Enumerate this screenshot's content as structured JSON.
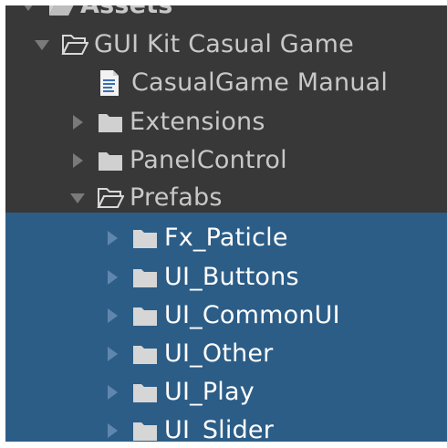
{
  "header": {
    "title": "Assets"
  },
  "tree": {
    "root": {
      "label": "GUI Kit Casual Game",
      "expanded": true
    },
    "children": [
      {
        "label": "CasualGame Manual",
        "type": "document"
      },
      {
        "label": "Extensions",
        "type": "folder",
        "expanded": false
      },
      {
        "label": "PanelControl",
        "type": "folder",
        "expanded": false
      },
      {
        "label": "Prefabs",
        "type": "folder",
        "expanded": true
      }
    ],
    "prefabs": [
      {
        "label": "Fx_Paticle",
        "selected": true
      },
      {
        "label": "UI_Buttons",
        "selected": true
      },
      {
        "label": "UI_CommonUI",
        "selected": true
      },
      {
        "label": "UI_Other",
        "selected": true
      },
      {
        "label": "UI_Play",
        "selected": true
      },
      {
        "label": "UI_Slider",
        "selected": true
      }
    ]
  },
  "colors": {
    "panel_bg": "#383838",
    "selection_bg": "#2c5d87",
    "text": "#c8c8c8",
    "text_selected": "#ffffff"
  }
}
